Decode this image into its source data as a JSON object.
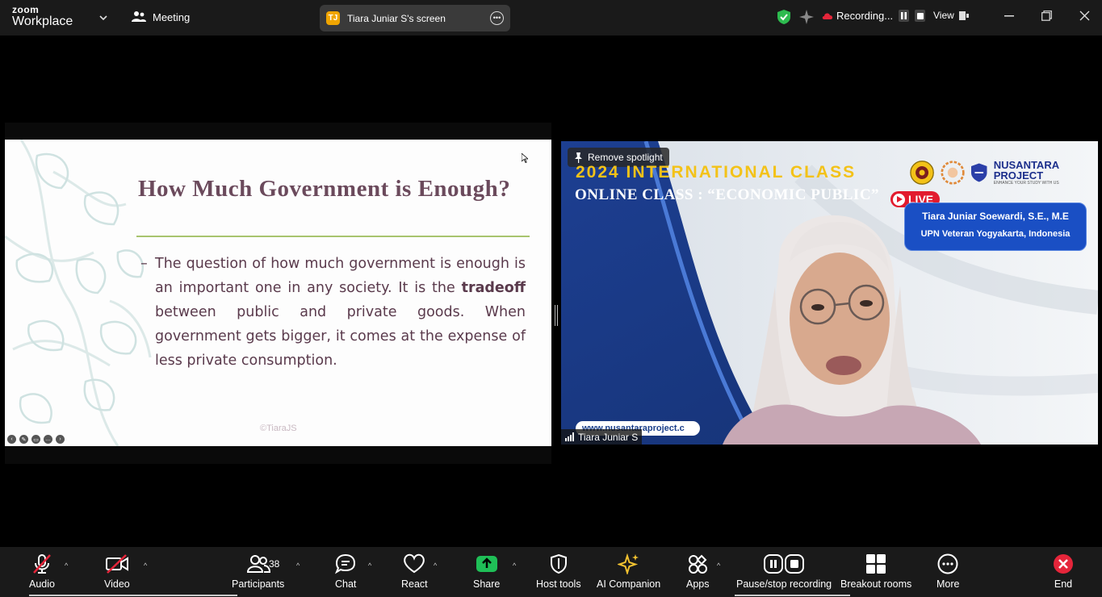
{
  "topbar": {
    "brand_top": "zoom",
    "brand_bottom": "Workplace",
    "meeting_label": "Meeting",
    "screen_tab_initial": "TJ",
    "screen_tab_label": "Tiara Juniar S's screen",
    "recording_label": "Recording...",
    "view_label": "View"
  },
  "slide": {
    "title": "How Much Government is Enough?",
    "dash": "–",
    "body_before": "The question of how much government is enough is an important one in any society. It is the ",
    "body_bold": "tradeoff",
    "body_after": " between public and private goods. When government gets bigger, it comes at the expense of less private consumption.",
    "copyright": "©TiaraJS"
  },
  "video": {
    "spotlight_label": "Remove spotlight",
    "banner_title": "2024 INTERNATIONAL CLASS",
    "banner_subtitle": "ONLINE CLASS : “ECONOMIC PUBLIC”",
    "live_label": "LIVE",
    "brand_name": "NUSANTARA PROJECT",
    "brand_tagline": "ENHANCE YOUR STUDY WITH US",
    "speaker_name": "Tiara Juniar Soewardi, S.E., M.E",
    "speaker_affiliation": "UPN Veteran Yogyakarta, Indonesia",
    "website": "www.nusantaraproject.c",
    "participant_name": "Tiara Juniar S"
  },
  "toolbar": {
    "audio": "Audio",
    "video": "Video",
    "participants": "Participants",
    "participants_count": "38",
    "chat": "Chat",
    "react": "React",
    "share": "Share",
    "host_tools": "Host tools",
    "ai_companion": "AI Companion",
    "apps": "Apps",
    "pause_stop": "Pause/stop recording",
    "breakout": "Breakout rooms",
    "more": "More",
    "end": "End"
  },
  "colors": {
    "share_green": "#1fbf57",
    "end_red": "#e5253a",
    "shield_green": "#2dbb4f",
    "ai_gold": "#f2c230",
    "slide_title": "#6b4a5c",
    "slide_rule": "#a8c46e"
  }
}
